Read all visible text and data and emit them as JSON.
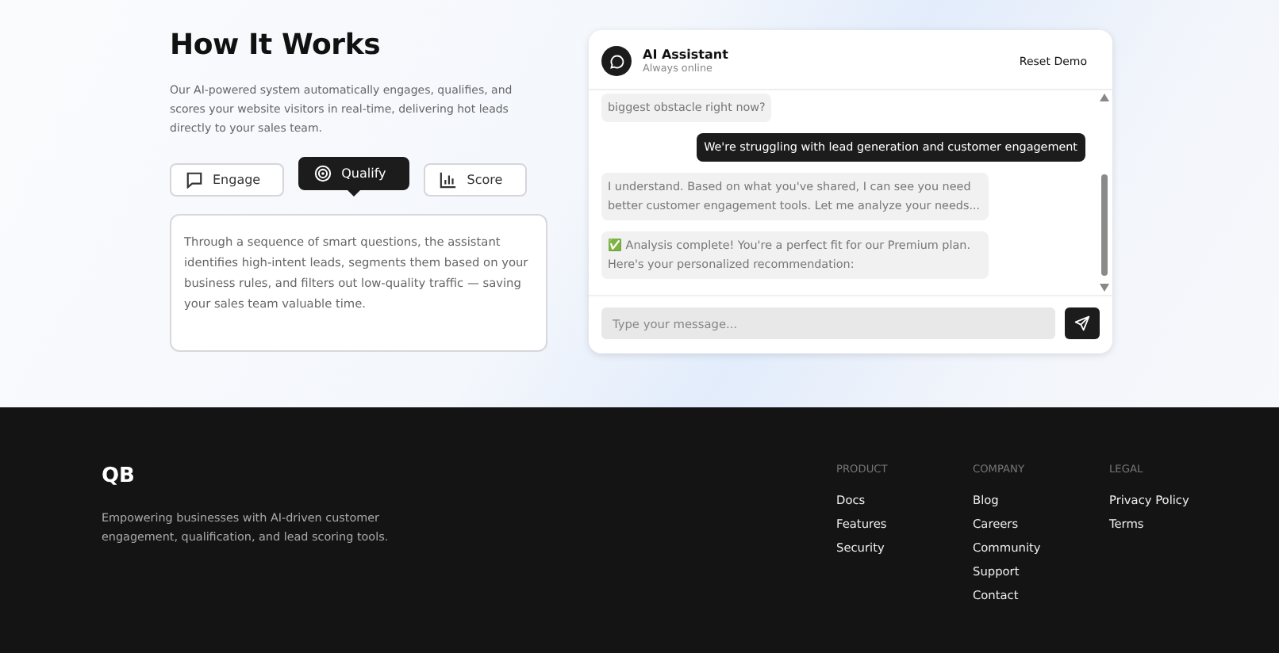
{
  "how_it_works": {
    "title": "How It Works",
    "description": "Our AI-powered system automatically engages, qualifies, and scores your website visitors in real-time, delivering hot leads directly to your sales team.",
    "tabs": [
      {
        "label": "Engage",
        "selected": false
      },
      {
        "label": "Qualify",
        "selected": true
      },
      {
        "label": "Score",
        "selected": false
      }
    ],
    "panel_text": "Through a sequence of smart questions, the assistant identifies high-intent leads, segments them based on your business rules, and filters out low-quality traffic — saving your sales team valuable time."
  },
  "chat": {
    "title": "AI Assistant",
    "status": "Always online",
    "reset_button": "Reset Demo",
    "messages": [
      {
        "kind": "bot",
        "text": "biggest obstacle right now?"
      },
      {
        "kind": "user",
        "text": "We're struggling with lead generation and customer engagement"
      },
      {
        "kind": "bot",
        "text": "I understand. Based on what you've shared, I can see you need better customer engagement tools. Let me analyze your needs..."
      },
      {
        "kind": "bot",
        "text": "✅ Analysis complete! You're a perfect fit for our Premium plan. Here's your personalized recommendation:"
      }
    ],
    "input": {
      "placeholder": "Type your message..."
    }
  },
  "footer": {
    "logo": "QB",
    "tagline": "Empowering businesses with AI-driven customer engagement, qualification, and lead scoring tools.",
    "columns": [
      {
        "heading": "PRODUCT",
        "links": [
          "Docs",
          "Features",
          "Security"
        ]
      },
      {
        "heading": "COMPANY",
        "links": [
          "Blog",
          "Careers",
          "Community",
          "Support",
          "Contact"
        ]
      },
      {
        "heading": "LEGAL",
        "links": [
          "Privacy Policy",
          "Terms"
        ]
      }
    ]
  }
}
